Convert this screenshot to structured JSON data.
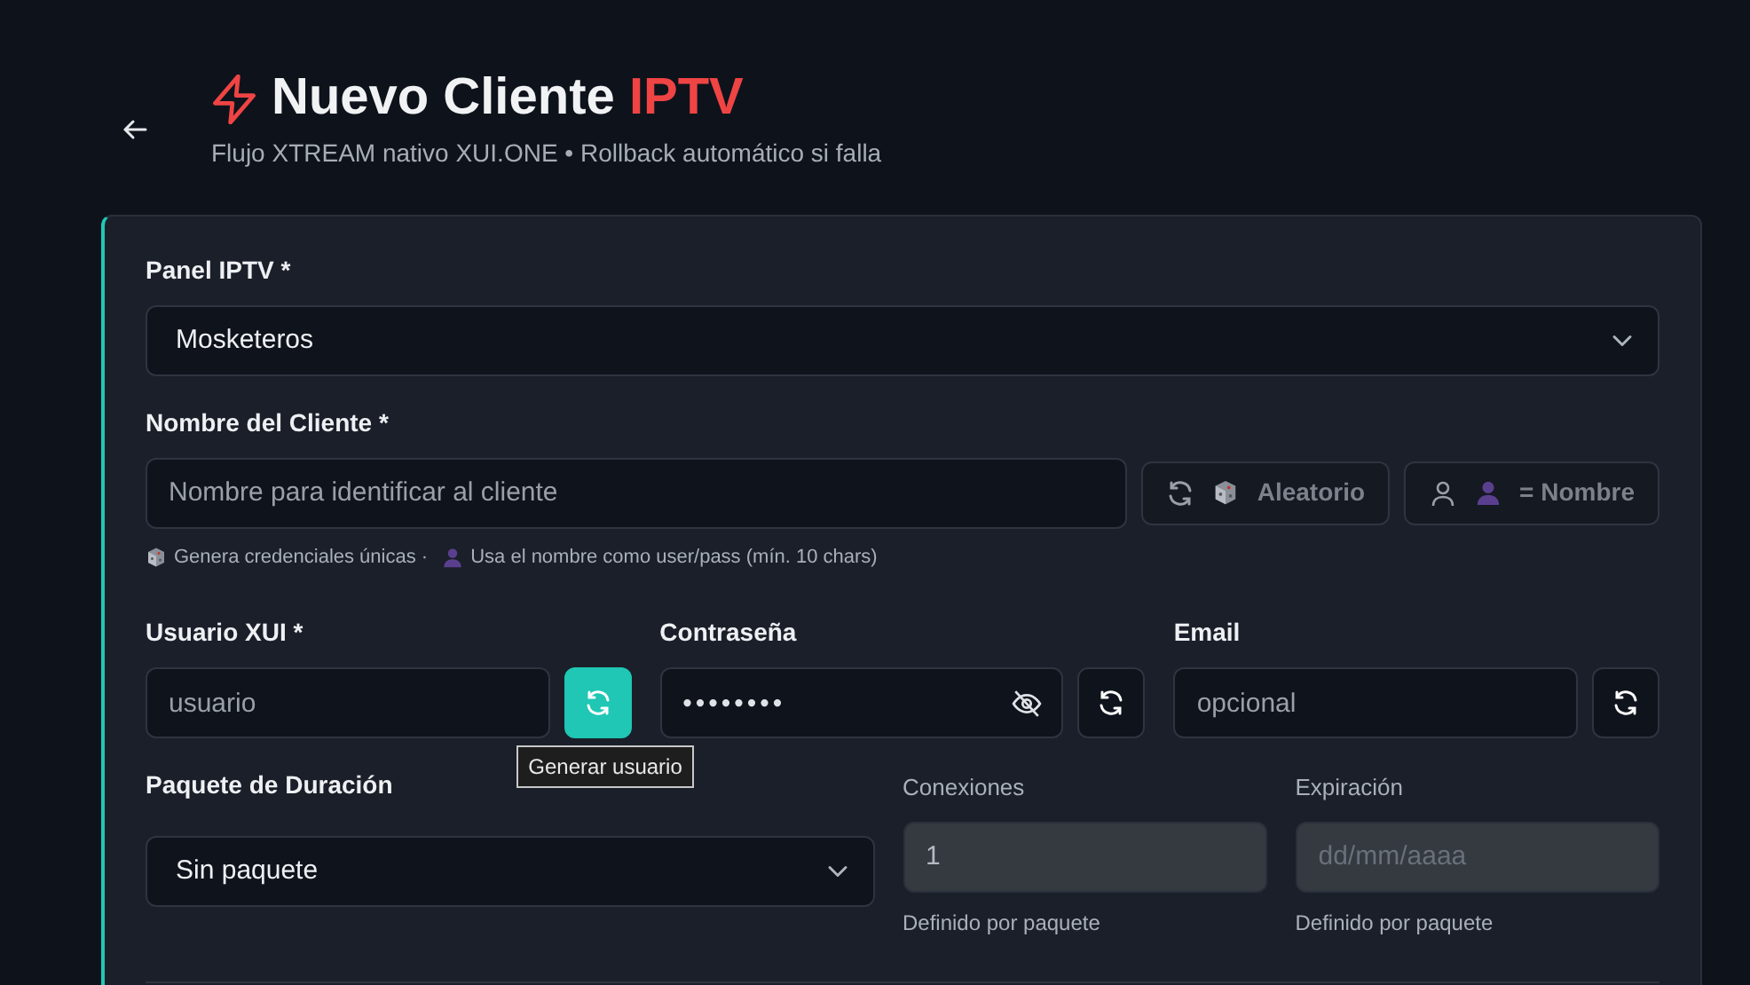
{
  "header": {
    "title": "Nuevo Cliente",
    "title_accent": "IPTV",
    "subtitle": "Flujo XTREAM nativo XUI.ONE • Rollback automático si falla"
  },
  "form": {
    "panel": {
      "label": "Panel IPTV *",
      "value": "Mosketeros"
    },
    "client_name": {
      "label": "Nombre del Cliente *",
      "placeholder": "Nombre para identificar al cliente",
      "buttons": [
        {
          "kind": "random",
          "label": "Aleatorio",
          "disabled": true
        },
        {
          "kind": "name",
          "label": "= Nombre",
          "disabled": true
        }
      ],
      "hint": [
        {
          "kind": "dice",
          "text": "Genera credenciales únicas ·"
        },
        {
          "kind": "person",
          "text": "Usa el nombre como user/pass (mín. 10 chars)"
        }
      ]
    },
    "credentials": [
      {
        "label": "Usuario XUI *",
        "placeholder": "usuario",
        "kind": "text",
        "button_highlighted": true,
        "tooltip": "Generar usuario"
      },
      {
        "label": "Contraseña",
        "value": "••••••••",
        "kind": "password",
        "button_highlighted": false
      },
      {
        "label": "Email",
        "placeholder": "opcional",
        "kind": "text",
        "button_highlighted": false
      }
    ],
    "package": {
      "label": "Paquete de Duración",
      "value": "Sin paquete"
    },
    "derived": [
      {
        "label": "Conexiones",
        "value": "1",
        "disabled": true,
        "help": "Definido por paquete"
      },
      {
        "label": "Expiración",
        "placeholder": "dd/mm/aaaa",
        "disabled": true,
        "help": "Definido por paquete"
      }
    ]
  }
}
